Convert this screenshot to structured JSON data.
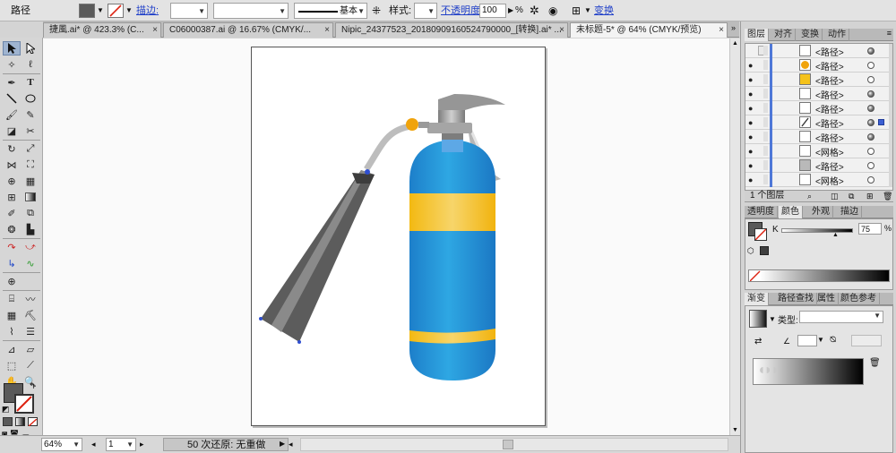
{
  "control_bar": {
    "object_type": "路径",
    "stroke_link": "描边:",
    "style_label": "样式:",
    "profile_label": "基本",
    "opacity_link": "不透明度:",
    "opacity_value": "100",
    "opacity_unit": "%",
    "transform_link": "变换",
    "fill_color": "#5a5a5a"
  },
  "tabs": [
    {
      "label": "捷風.ai* @ 423.3% (C..."
    },
    {
      "label": "C06000387.ai @ 16.67% (CMYK/..."
    },
    {
      "label": "Nipic_24377523_20180909160524790000_[转换].ai* ..."
    },
    {
      "label": "未标题-5* @ 64% (CMYK/预览)"
    }
  ],
  "tools": {
    "selection_icon": "selection-arrow-icon",
    "type_glyph": "T"
  },
  "status": {
    "zoom": "64%",
    "page": "1",
    "info": "50 次还原: 无重做"
  },
  "panels": {
    "layers_tabs": [
      "图层",
      "对齐",
      "变换",
      "动作"
    ],
    "layers": [
      {
        "label": "<路径>",
        "thumb": "empty",
        "target": "filled"
      },
      {
        "label": "<路径>",
        "thumb": "orange-circle",
        "target": "empty"
      },
      {
        "label": "<路径>",
        "thumb": "yellow",
        "target": "empty"
      },
      {
        "label": "<路径>",
        "thumb": "empty",
        "target": "filled"
      },
      {
        "label": "<路径>",
        "thumb": "empty",
        "target": "filled"
      },
      {
        "label": "<路径>",
        "thumb": "slash",
        "target": "filled",
        "selected": true
      },
      {
        "label": "<路径>",
        "thumb": "empty",
        "target": "filled"
      },
      {
        "label": "<网格>",
        "thumb": "empty",
        "target": "empty"
      },
      {
        "label": "<路径>",
        "thumb": "gray",
        "target": "empty"
      },
      {
        "label": "<网格>",
        "thumb": "empty",
        "target": "empty"
      }
    ],
    "layers_footer": "1 个图层",
    "color_tabs": [
      "透明度",
      "颜色",
      "外观",
      "描边"
    ],
    "k_label": "K",
    "k_value": "75",
    "k_unit": "%",
    "gradient_tabs": [
      "渐变",
      "路径查找",
      "属性",
      "颜色参考"
    ],
    "gradient_type_label": "类型:"
  },
  "colors": {
    "extinguisher_body": "#2a9fdc",
    "band": "#f5c219",
    "valve": "#9a9a9a",
    "hose": "#5f5f5f",
    "selection_accent": "#3b5fd2"
  }
}
